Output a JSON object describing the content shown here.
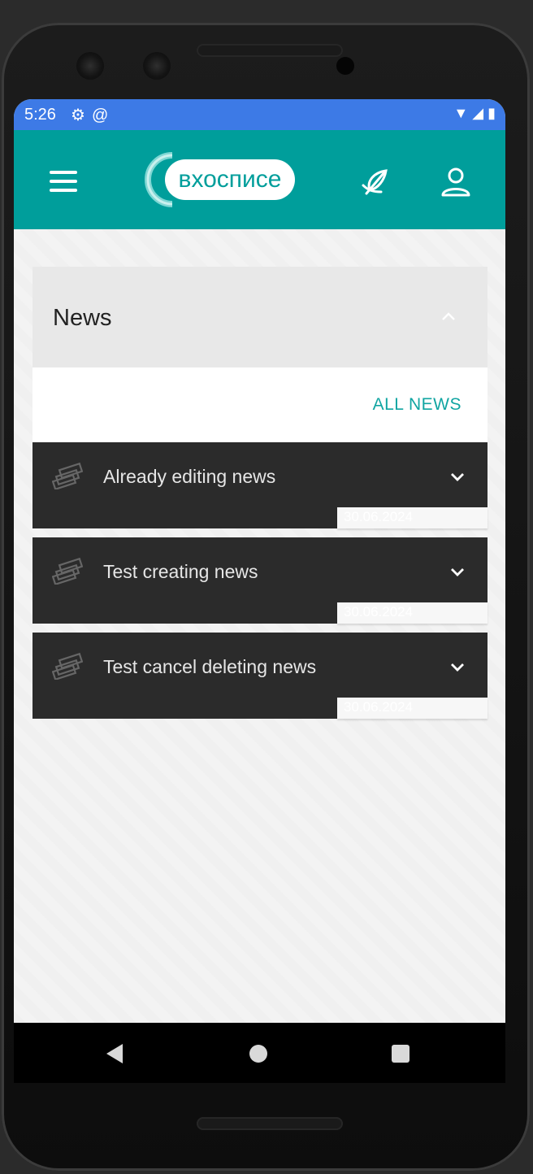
{
  "status_bar": {
    "time": "5:26",
    "left_icons": [
      "settings-icon",
      "at-sign-icon"
    ],
    "right_icons": [
      "wifi-icon",
      "signal-icon",
      "battery-icon"
    ],
    "color": "#3d7ae6"
  },
  "app_bar": {
    "logo_text": "вхосписе",
    "color": "#009e9b",
    "icons": [
      "menu-icon",
      "feather-icon",
      "profile-icon"
    ]
  },
  "news_section": {
    "title": "News",
    "all_news_label": "ALL NEWS",
    "accent_color": "#11a5a2",
    "items": [
      {
        "title": "Already editing news",
        "date": "30.06.2024",
        "icon": "money-stack-icon"
      },
      {
        "title": "Test creating news",
        "date": "30.06.2024",
        "icon": "money-stack-icon"
      },
      {
        "title": "Test cancel deleting news",
        "date": "30.06.2024",
        "icon": "money-stack-icon"
      }
    ]
  },
  "nav_bar": {
    "icons": [
      "back-icon",
      "home-icon",
      "recents-icon"
    ]
  }
}
